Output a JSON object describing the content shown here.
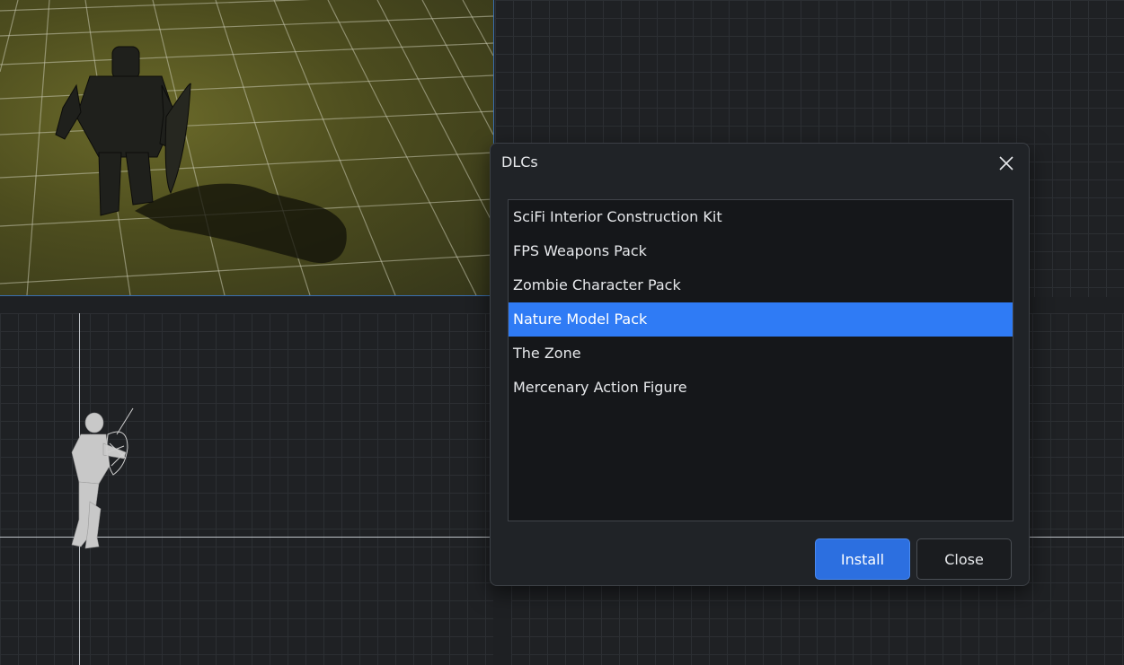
{
  "dialog": {
    "title": "DLCs",
    "close_icon": "close-icon",
    "items": [
      {
        "label": "SciFi Interior Construction Kit",
        "selected": false
      },
      {
        "label": "FPS Weapons Pack",
        "selected": false
      },
      {
        "label": "Zombie Character Pack",
        "selected": false
      },
      {
        "label": "Nature Model Pack",
        "selected": true
      },
      {
        "label": "The Zone",
        "selected": false
      },
      {
        "label": "Mercenary Action Figure",
        "selected": false
      }
    ],
    "install_label": "Install",
    "close_label": "Close"
  },
  "colors": {
    "selection": "#2f7bf5",
    "install_button": "#2c6fe0",
    "viewport_border": "#3a6fb0"
  }
}
